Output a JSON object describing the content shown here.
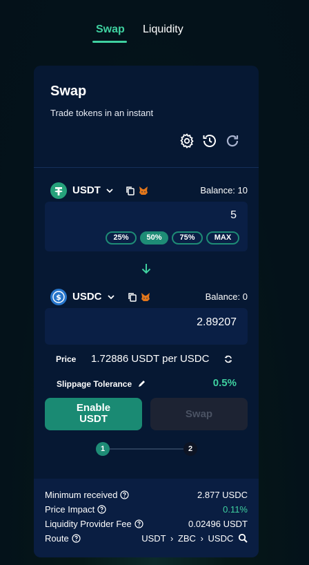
{
  "nav": {
    "tabs": [
      {
        "label": "Swap",
        "active": true
      },
      {
        "label": "Liquidity",
        "active": false
      }
    ]
  },
  "card": {
    "title": "Swap",
    "subtitle": "Trade tokens in an instant",
    "icons": [
      "gear-icon",
      "history-icon",
      "refresh-icon"
    ]
  },
  "from": {
    "token": "USDT",
    "balance_label": "Balance: 10",
    "amount": "5",
    "percent_buttons": [
      "25%",
      "50%",
      "75%",
      "MAX"
    ],
    "active_percent": "50%",
    "color": "#26a17b"
  },
  "to": {
    "token": "USDC",
    "balance_label": "Balance: 0",
    "amount": "2.89207",
    "color": "#2775ca"
  },
  "price": {
    "label": "Price",
    "value": "1.72886 USDT per USDC"
  },
  "slippage": {
    "label": "Slippage Tolerance",
    "value": "0.5%"
  },
  "buttons": {
    "enable_line1": "Enable",
    "enable_line2": "USDT",
    "swap": "Swap"
  },
  "steps": [
    "1",
    "2"
  ],
  "details": {
    "min_received_label": "Minimum received",
    "min_received_value": "2.877 USDC",
    "price_impact_label": "Price Impact",
    "price_impact_value": "0.11%",
    "lp_fee_label": "Liquidity Provider Fee",
    "lp_fee_value": "0.02496 USDT",
    "route_label": "Route",
    "route": [
      "USDT",
      "ZBC",
      "USDC"
    ],
    "route_separator": "›"
  },
  "colors": {
    "accent": "#3fd1a0",
    "button": "#1a8a73",
    "card": "#061833",
    "input": "#0a1f45"
  }
}
